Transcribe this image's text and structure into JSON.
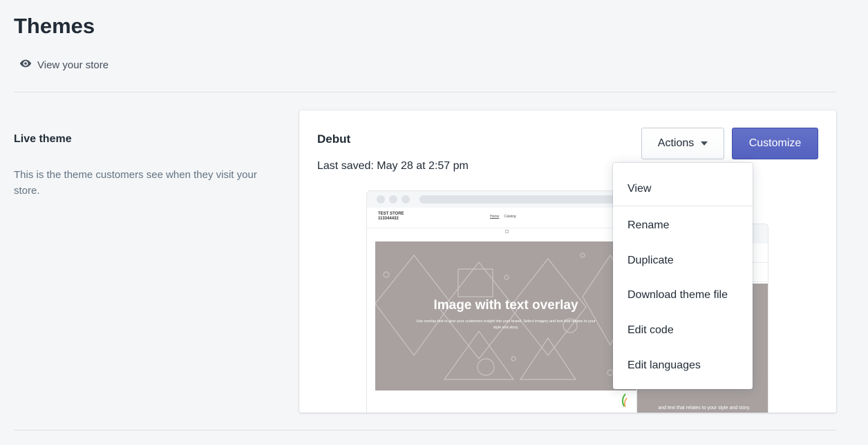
{
  "header": {
    "title": "Themes",
    "view_store_label": "View your store"
  },
  "live_theme": {
    "heading": "Live theme",
    "description": "This is the theme customers see when they visit your store."
  },
  "theme_card": {
    "name": "Debut",
    "last_saved": "Last saved: May 28 at 2:57 pm",
    "actions_label": "Actions",
    "customize_label": "Customize"
  },
  "preview": {
    "store_name_line1": "TEST STORE",
    "store_name_line2": "113344432",
    "nav": [
      "Home",
      "Catalog"
    ],
    "hero_title": "Image with text overlay",
    "hero_subtitle": "Use overlay text to give your customers insight into your brand. Select imagery and text that relates to your style and story.",
    "back_caption": "and text that relates to your style and story."
  },
  "dropdown": {
    "items": [
      "View",
      "Rename",
      "Duplicate",
      "Download theme file",
      "Edit code",
      "Edit languages"
    ]
  },
  "colors": {
    "primary": "#5c6ac4",
    "background": "#f4f6f8",
    "hero_gray": "#a8a1a0"
  },
  "icons": {
    "view_store": "eye-icon",
    "actions_caret": "caret-down-icon"
  }
}
